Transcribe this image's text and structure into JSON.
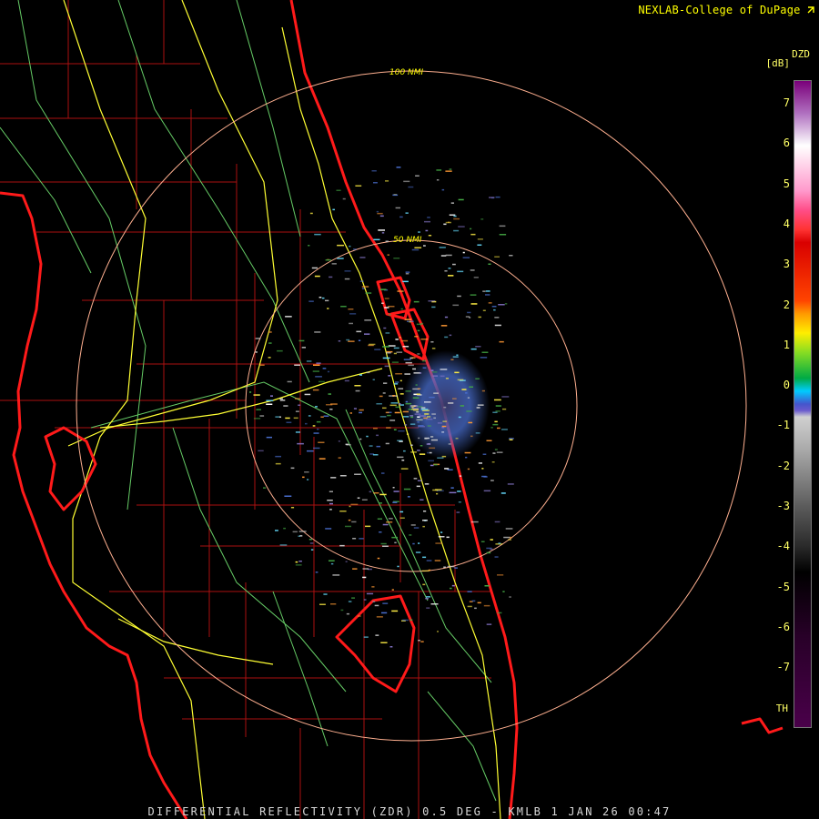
{
  "credit": "NEXLAB-College of DuPage",
  "credit_icon": "external-link-icon",
  "footer": "DIFFERENTIAL REFLECTIVITY (ZDR) 0.5 DEG - KMLB 1 JAN 26 00:47",
  "legend": {
    "product": "DZD",
    "unit": "[dB]",
    "ticks": [
      "7",
      "6",
      "5",
      "4",
      "3",
      "2",
      "1",
      "0",
      "-1",
      "-2",
      "-3",
      "-4",
      "-5",
      "-6",
      "-7"
    ],
    "threshold_label": "TH"
  },
  "rings": {
    "inner_label": "50 NMI",
    "outer_label": "100 NMI"
  },
  "colors": {
    "coastline": "#ff1a1a",
    "highways": "#ffff33",
    "rivers": "#66cc66",
    "counties": "#aa1111",
    "range_rings": "#ffb090",
    "text": "#ffff00"
  }
}
